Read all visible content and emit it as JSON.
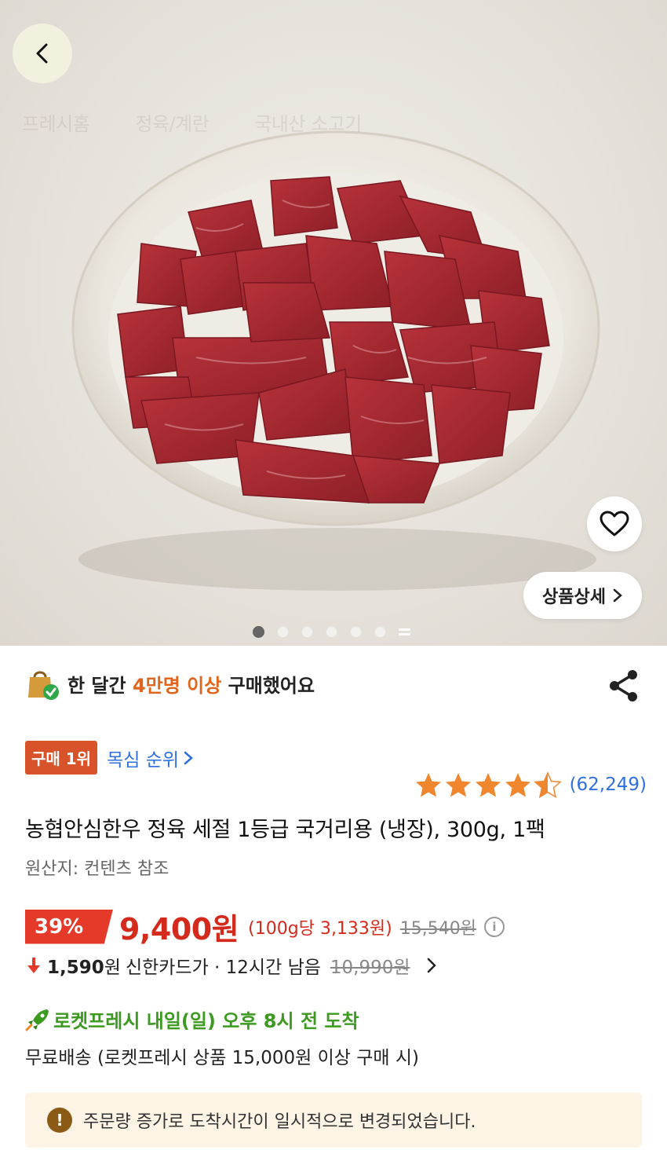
{
  "hero": {
    "breadcrumb": [
      "프레시홈",
      "정육/계란",
      "국내산 소고기"
    ],
    "detail_label": "상품상세",
    "image_count": 7,
    "active_image": 1
  },
  "social_proof": {
    "prefix": "한 달간 ",
    "highlight": "4만명 이상",
    "suffix": " 구매했어요"
  },
  "rank": {
    "badge": "구매 1위",
    "link_label": "목심 순위"
  },
  "rating": {
    "stars": 4.5,
    "count": "(62,249)"
  },
  "product": {
    "title": "농협안심한우 정육 세절 1등급 국거리용 (냉장), 300g, 1팩",
    "origin": "원산지: 컨텐츠 참조"
  },
  "price": {
    "discount": "39%",
    "sale": "9,400원",
    "unit": "(100g당 3,133원)",
    "original": "15,540원",
    "info_icon": "i"
  },
  "card_offer": {
    "arrow": "🡇",
    "amount": "1,590",
    "amount_suffix": "원",
    "text": "신한카드가 · 12시간 남음",
    "strike_price": "10,990원"
  },
  "delivery": {
    "label": "로켓프레시 내일(일) 오후 8시 전 도착",
    "shipping": "무료배송 (로켓프레시 상품 15,000원 이상 구매 시)"
  },
  "notice": {
    "icon": "!",
    "text": "주문량 증가로 도착시간이 일시적으로 변경되었습니다."
  },
  "colors": {
    "discount_red": "#e53a2a",
    "price_red": "#d32a1c",
    "link_blue": "#2f6fe0",
    "rocket_green": "#3b9a1f",
    "rank_orange": "#d8532a",
    "star_orange": "#f0862e",
    "notice_bg": "#fdf4e6"
  }
}
